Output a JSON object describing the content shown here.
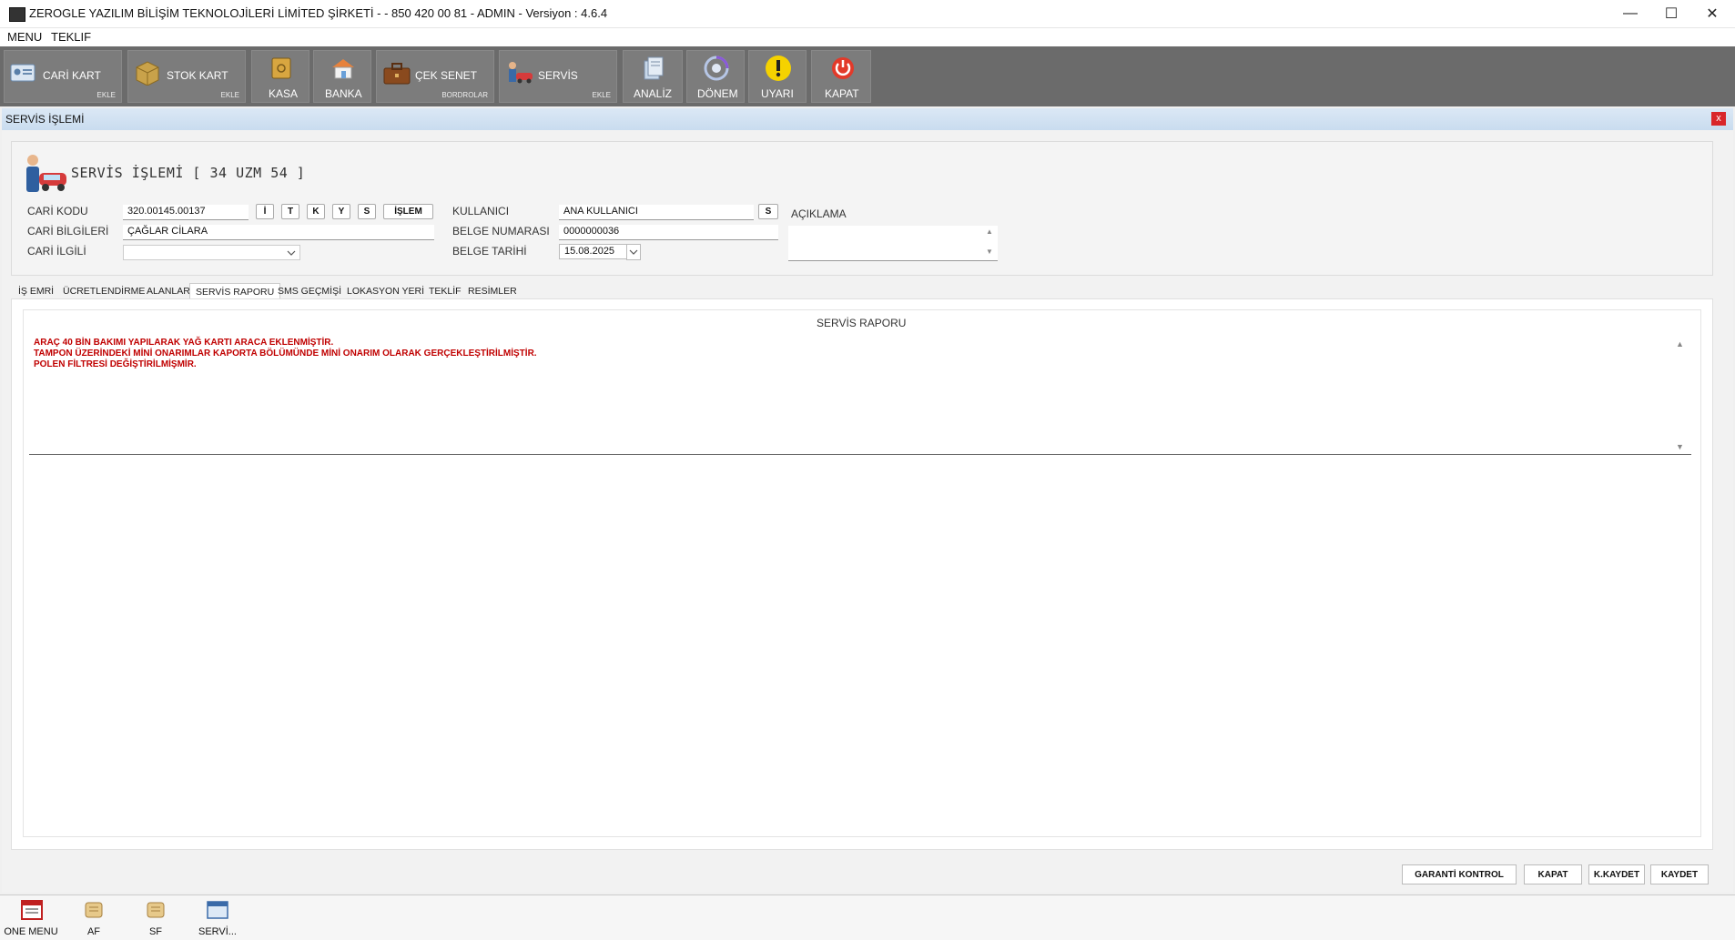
{
  "window": {
    "title": "ZEROGLE YAZILIM BİLİŞİM TEKNOLOJİLERİ LİMİTED ŞİRKETİ -  - 850 420 00 81 - ADMIN -  Versiyon : 4.6.4",
    "minimize": "—",
    "maximize": "☐",
    "close": "✕"
  },
  "menu": [
    "MENU",
    "TEKLIF"
  ],
  "toolbar": [
    {
      "label": "CARİ KART",
      "sub": "EKLE",
      "icon": "id-card-icon"
    },
    {
      "label": "STOK KART",
      "sub": "EKLE",
      "icon": "box-icon"
    },
    {
      "label": "KASA",
      "sub": "",
      "icon": "safe-icon"
    },
    {
      "label": "BANKA",
      "sub": "",
      "icon": "bank-icon"
    },
    {
      "label": "ÇEK SENET",
      "sub": "BORDROLAR",
      "icon": "briefcase-icon"
    },
    {
      "label": "SERVİS",
      "sub": "EKLE",
      "icon": "car-service-icon"
    },
    {
      "label": "ANALİZ",
      "sub": "",
      "icon": "analysis-icon"
    },
    {
      "label": "DÖNEM",
      "sub": "",
      "icon": "period-icon"
    },
    {
      "label": "UYARI",
      "sub": "",
      "icon": "warning-icon"
    },
    {
      "label": "KAPAT",
      "sub": "",
      "icon": "power-icon"
    }
  ],
  "child_window": {
    "title": "SERVİS İŞLEMİ",
    "close": "x"
  },
  "form": {
    "page_title": "SERVİS İŞLEMİ [ 34 UZM 54 ]",
    "cari_kodu_label": "CARİ KODU",
    "cari_kodu_value": "320.00145.00137",
    "cari_buttons": [
      "İ",
      "T",
      "K",
      "Y",
      "S"
    ],
    "islem_button": "İŞLEM",
    "cari_bilgileri_label": "CARİ BİLGİLERİ",
    "cari_bilgileri_value": "ÇAĞLAR CİLARA",
    "cari_ilgili_label": "CARİ İLGİLİ",
    "cari_ilgili_value": "",
    "kullanici_label": "KULLANICI",
    "kullanici_value": "ANA KULLANICI",
    "kullanici_button": "S",
    "belge_numarasi_label": "BELGE NUMARASI",
    "belge_numarasi_value": "0000000036",
    "belge_tarihi_label": "BELGE TARİHİ",
    "belge_tarihi_value": "15.08.2025",
    "aciklama_label": "AÇIKLAMA",
    "aciklama_value": ""
  },
  "tabs": [
    {
      "label": "İŞ EMRİ"
    },
    {
      "label": "ÜCRETLENDİRME"
    },
    {
      "label": "ALANLAR"
    },
    {
      "label": "SERVİS RAPORU",
      "active": true
    },
    {
      "label": "SMS GEÇMİŞİ"
    },
    {
      "label": "LOKASYON YERİ"
    },
    {
      "label": "TEKLİF"
    },
    {
      "label": "RESİMLER"
    }
  ],
  "report": {
    "header": "SERVİS RAPORU",
    "lines": [
      "ARAÇ 40 BİN BAKIMI YAPILARAK YAĞ KARTI ARACA EKLENMİŞTİR.",
      "TAMPON ÜZERİNDEKİ MİNİ ONARIMLAR KAPORTA BÖLÜMÜNDE MİNİ ONARIM OLARAK GERÇEKLEŞTİRİLMİŞTİR.",
      "POLEN FİLTRESİ DEĞİŞTİRİLMİŞMİR."
    ]
  },
  "bottom_buttons": {
    "garanti": "GARANTİ KONTROL",
    "kapat": "KAPAT",
    "kkaydet": "K.KAYDET",
    "kaydet": "KAYDET"
  },
  "taskbar": [
    {
      "label": "ONE MENU",
      "icon": "menu-window-icon"
    },
    {
      "label": "AF",
      "icon": "scroll-icon"
    },
    {
      "label": "SF",
      "icon": "scroll-icon"
    },
    {
      "label": "SERVİ...",
      "icon": "window-icon"
    }
  ],
  "colors": {
    "toolbar_bg": "#6b6b6b",
    "report_text": "#c00000",
    "child_title_bg": "#c9dcef"
  }
}
